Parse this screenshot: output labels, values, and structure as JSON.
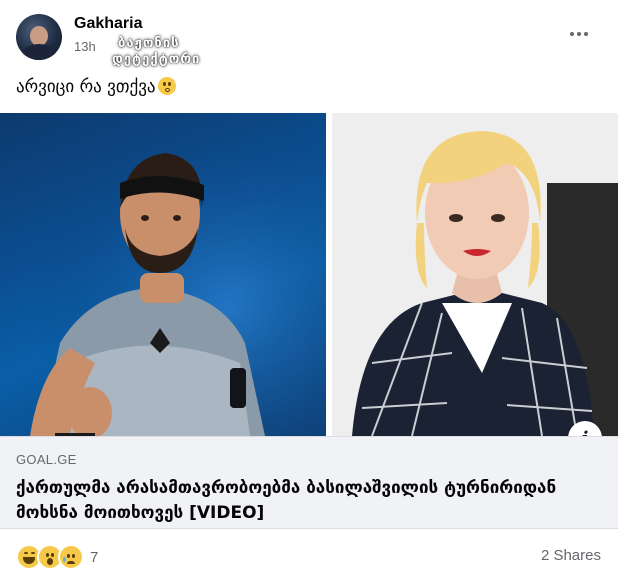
{
  "post": {
    "author": "Gakharia",
    "time": "13h",
    "watermark": {
      "line1": "ბაჟონის",
      "line2": "დეტექტორი"
    },
    "caption": "არვიცი რა ვთქვა",
    "caption_emoji": "flushed-face-emoji"
  },
  "link_preview": {
    "domain": "GOAL.GE",
    "headline": "ქართულმა არასამთავრობოებმა ბასილაშვილის ტურნირიდან მოხსნა მოითხოვეს [VIDEO]",
    "info_icon": "info-icon"
  },
  "footer": {
    "reactions": [
      "haha-reaction-icon",
      "wow-reaction-icon",
      "sad-reaction-icon"
    ],
    "reaction_count": "7",
    "shares": "2 Shares"
  },
  "colors": {
    "secondary_text": "#65676b",
    "link_box_bg": "#f0f2f5",
    "tennis_court_blue": "#0b4d8f",
    "reaction_yellow": "#f7c948"
  }
}
